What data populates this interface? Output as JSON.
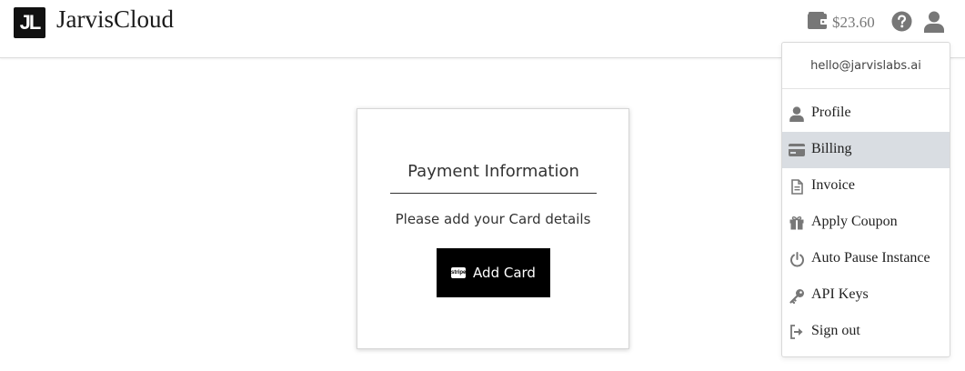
{
  "header": {
    "logo_text": "JL",
    "brand": "JarvisCloud",
    "balance": "$23.60",
    "icons": {
      "wallet": "wallet-icon",
      "help": "help-circle-icon",
      "user": "user-icon"
    }
  },
  "payment": {
    "title": "Payment Information",
    "subtitle": "Please add your Card details",
    "button_label": "Add Card",
    "button_icon": "stripe-icon",
    "button_icon_text": "stripe"
  },
  "user_menu": {
    "email": "hello@jarvislabs.ai",
    "items": [
      {
        "label": "Profile",
        "icon": "user-icon",
        "active": false
      },
      {
        "label": "Billing",
        "icon": "credit-card-icon",
        "active": true
      },
      {
        "label": "Invoice",
        "icon": "document-icon",
        "active": false
      },
      {
        "label": "Apply Coupon",
        "icon": "gift-icon",
        "active": false
      },
      {
        "label": "Auto Pause Instance",
        "icon": "power-icon",
        "active": false
      },
      {
        "label": "API Keys",
        "icon": "key-icon",
        "active": false
      },
      {
        "label": "Sign out",
        "icon": "sign-out-icon",
        "active": false
      }
    ]
  },
  "colors": {
    "active_item_bg": "#d9dde2",
    "button_bg": "#000000",
    "icon_gray": "#777777"
  }
}
